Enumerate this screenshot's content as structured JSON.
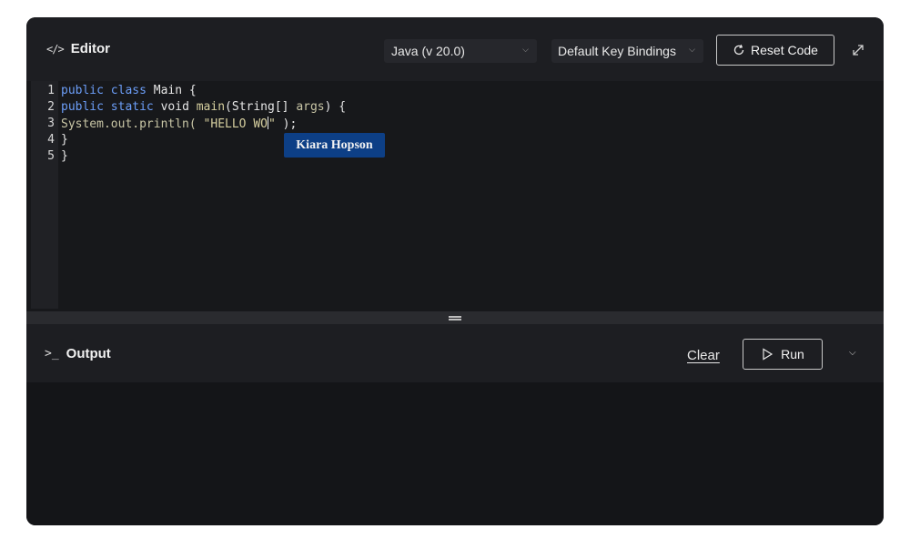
{
  "editor": {
    "title": "Editor",
    "language": "Java (v 20.0)",
    "key_bindings": "Default Key Bindings",
    "reset_label": "Reset Code"
  },
  "code": {
    "line_numbers": [
      "1",
      "2",
      "3",
      "4",
      "5"
    ],
    "lines": [
      {
        "kw1": "public",
        "kw2": "class",
        "rest": " Main {"
      },
      {
        "kw1": "public",
        "kw2": "static",
        "mid": " void ",
        "fn": "main",
        "rest": "(String[] ",
        "arg": "args",
        "tail": ") {"
      },
      {
        "obj": "System.out.println(",
        "str": " \"HELLO WO",
        "str_end": "\"",
        "tail": " );"
      },
      {
        "text": "}"
      },
      {
        "text": "}"
      }
    ],
    "collaborator": "Kiara Hopson"
  },
  "output": {
    "title": "Output",
    "clear_label": "Clear",
    "run_label": "Run"
  },
  "colors": {
    "card_bg": "#1d1e22",
    "keyword": "#6c9ef8",
    "string": "#d6cf9f",
    "tooltip_bg": "#0d3f86"
  }
}
